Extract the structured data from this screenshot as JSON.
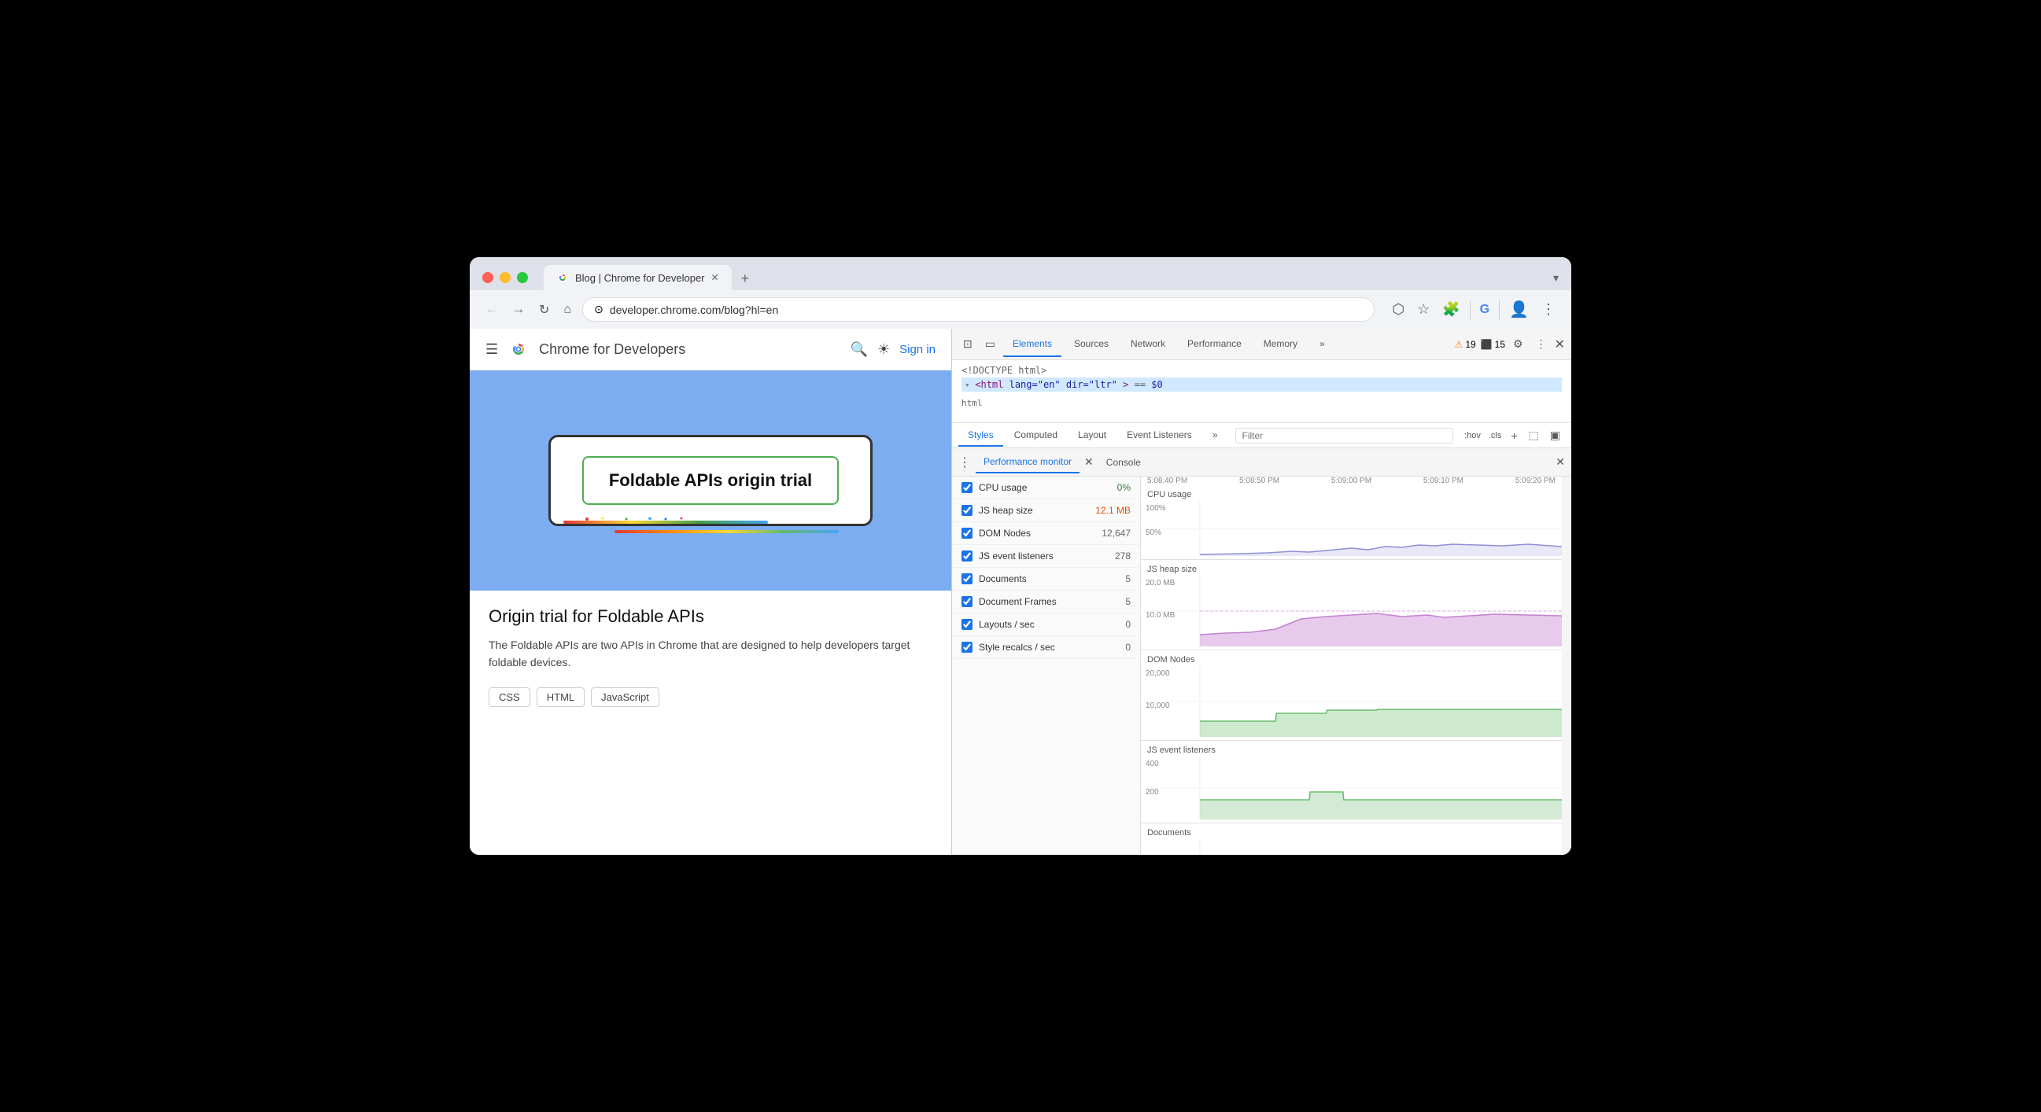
{
  "browser": {
    "tab_title": "Blog | Chrome for Developer",
    "url": "developer.chrome.com/blog?hl=en",
    "new_tab_icon": "+",
    "expand_icon": "▾"
  },
  "nav": {
    "back_label": "←",
    "forward_label": "→",
    "refresh_label": "↻",
    "home_label": "⌂",
    "security_icon": "⊙"
  },
  "site": {
    "name": "Chrome for Developers",
    "sign_in": "Sign in"
  },
  "article": {
    "card_title": "Foldable APIs origin trial",
    "heading": "Origin trial for Foldable APIs",
    "description": "The Foldable APIs are two APIs in Chrome that are designed to help developers target foldable devices.",
    "tags": [
      "CSS",
      "HTML",
      "JavaScript"
    ]
  },
  "devtools": {
    "tabs": [
      "Elements",
      "Sources",
      "Network",
      "Performance",
      "Memory"
    ],
    "active_tab": "Elements",
    "more_tabs": "»",
    "warnings_count": "19",
    "errors_count": "15",
    "settings_icon": "⚙",
    "more_icon": "⋮",
    "close_icon": "✕",
    "html_doctype": "<!DOCTYPE html>",
    "html_tag": "<html lang=\"en\" dir=\"ltr\"> == $0",
    "breadcrumb": "html"
  },
  "styles_panel": {
    "tabs": [
      "Styles",
      "Computed",
      "Layout",
      "Event Listeners"
    ],
    "active_tab": "Styles",
    "more": "»",
    "filter_placeholder": "Filter",
    "hov_label": ":hov",
    "cls_label": ".cls"
  },
  "perf_monitor": {
    "title": "Performance monitor",
    "console_tab": "Console",
    "metrics": [
      {
        "id": "cpu",
        "label": "CPU usage",
        "value": "0%",
        "value_class": "perf-value-green",
        "checked": true
      },
      {
        "id": "heap",
        "label": "JS heap size",
        "value": "12.1 MB",
        "value_class": "perf-value-orange",
        "checked": true
      },
      {
        "id": "dom",
        "label": "DOM Nodes",
        "value": "12,647",
        "value_class": "",
        "checked": true
      },
      {
        "id": "events",
        "label": "JS event listeners",
        "value": "278",
        "value_class": "",
        "checked": true
      },
      {
        "id": "docs",
        "label": "Documents",
        "value": "5",
        "value_class": "",
        "checked": true
      },
      {
        "id": "frames",
        "label": "Document Frames",
        "value": "5",
        "value_class": "",
        "checked": true
      },
      {
        "id": "layouts",
        "label": "Layouts / sec",
        "value": "0",
        "value_class": "",
        "checked": true
      },
      {
        "id": "styles",
        "label": "Style recalcs / sec",
        "value": "0",
        "value_class": "",
        "checked": true
      }
    ],
    "time_labels": [
      "5:08:40 PM",
      "5:08:50 PM",
      "5:09:00 PM",
      "5:09:10 PM",
      "5:09:20 PM"
    ],
    "charts": [
      {
        "id": "cpu",
        "title": "CPU usage",
        "y_labels": [
          "100%",
          "50%"
        ],
        "color": "rgba(100,100,200,0.4)"
      },
      {
        "id": "heap",
        "title": "JS heap size",
        "y_labels": [
          "20.0 MB",
          "10.0 MB"
        ],
        "color": "rgba(186,104,200,0.4)"
      },
      {
        "id": "dom",
        "title": "DOM Nodes",
        "y_labels": [
          "20,000",
          "10,000"
        ],
        "color": "rgba(129,199,132,0.4)"
      },
      {
        "id": "events",
        "title": "JS event listeners",
        "y_labels": [
          "400",
          "200"
        ],
        "color": "rgba(129,199,132,0.35)"
      },
      {
        "id": "documents",
        "title": "Documents",
        "y_labels": [],
        "color": "rgba(129,199,132,0.3)"
      }
    ]
  }
}
